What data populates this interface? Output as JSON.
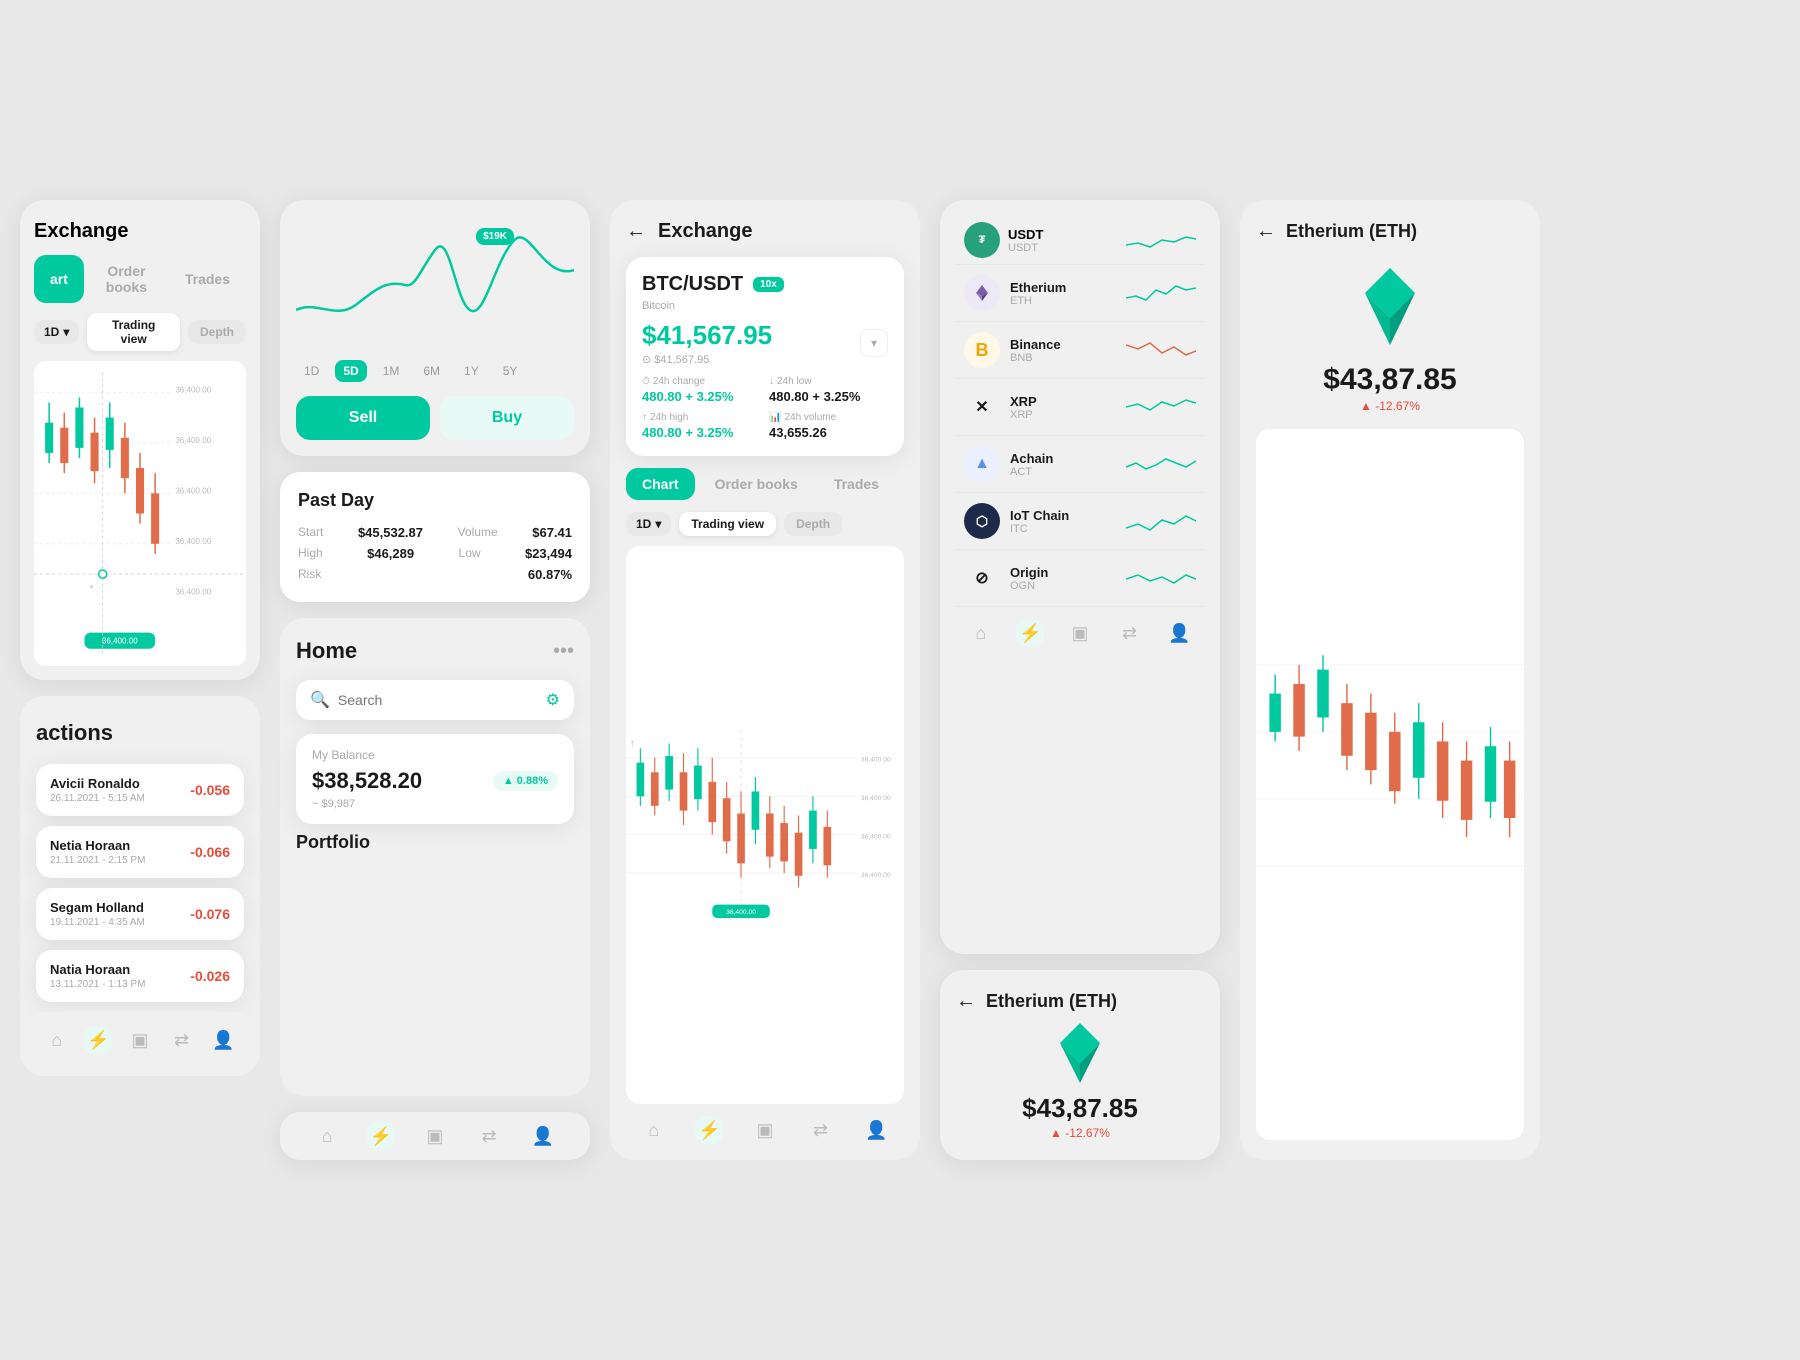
{
  "transactions": {
    "title": "actions",
    "items": [
      {
        "name": "Avicii Ronaldo",
        "date": "26.11.2021 - 5:15 AM",
        "amount": "-0.056"
      },
      {
        "name": "Netia Horaan",
        "date": "21.11.2021 - 2:15 PM",
        "amount": "-0.066"
      },
      {
        "name": "Segam Holland",
        "date": "19.11.2021 - 4:35 AM",
        "amount": "-0.076"
      },
      {
        "name": "Natia Horaan",
        "date": "13.11.2021 - 1:13 PM",
        "amount": "-0.026"
      }
    ]
  },
  "chart": {
    "badge": "$19K",
    "timeFilters": [
      "1D",
      "5D",
      "1M",
      "6M",
      "1Y",
      "5Y"
    ],
    "activeFilter": "5D",
    "sell": "Sell",
    "buy": "Buy"
  },
  "pastDay": {
    "title": "Past Day",
    "start_label": "Start",
    "start_value": "$45,532.87",
    "volume_label": "Volume",
    "volume_value": "$67.41",
    "high_label": "High",
    "high_value": "$46,289",
    "low_label": "Low",
    "low_value": "$23,494",
    "risk_label": "Risk",
    "risk_value": "60.87%"
  },
  "home": {
    "title": "Home",
    "search_placeholder": "Search",
    "balance_label": "My Balance",
    "balance_amount": "$38,528.20",
    "balance_change": "0.88%",
    "balance_sub": "~ $9,987",
    "portfolio_label": "Portfolio"
  },
  "exchange": {
    "title": "Exchange",
    "pair": "BTC/USDT",
    "leverage": "10x",
    "coin": "Bitcoin",
    "price": "$41,567.95",
    "price_sub": "⊙ $41,567.95",
    "change_label": "24h change",
    "change_value": "480.80 + 3.25%",
    "low_label": "24h low",
    "low_value": "480.80 + 3.25%",
    "high_label": "24h high",
    "high_value": "480.80 + 3.25%",
    "volume_label": "24h volume",
    "volume_value": "43,655.26",
    "tabs": [
      "Chart",
      "Order books",
      "Trades"
    ],
    "active_tab": "Chart",
    "timeframe": "1D",
    "views": [
      "Trading view",
      "Depth"
    ],
    "active_view": "Trading view",
    "price_levels": [
      "36,400.00",
      "36,400.00",
      "36,400.00",
      "36,400.00",
      "36,400.00"
    ]
  },
  "cryptoList": {
    "items": [
      {
        "name": "Etherium",
        "ticker": "ETH",
        "color": "#7b5ea7",
        "symbol": "◆"
      },
      {
        "name": "Binance",
        "ticker": "BNB",
        "color": "#f0a500",
        "symbol": "B"
      },
      {
        "name": "XRP",
        "ticker": "XRP",
        "color": "#1a1a1a",
        "symbol": "✕"
      },
      {
        "name": "Achain",
        "ticker": "ACT",
        "color": "#5b8dee",
        "symbol": "▲"
      },
      {
        "name": "IoT Chain",
        "ticker": "ITC",
        "color": "#2c3e6b",
        "symbol": "⬡"
      },
      {
        "name": "Origin",
        "ticker": "OGN",
        "color": "#1a1a1a",
        "symbol": "⊘"
      }
    ]
  },
  "ethDetail": {
    "back": "←",
    "title": "Etherium (ETH)",
    "price": "$43,87.85",
    "change": "▲ -12.67%"
  },
  "ethFull": {
    "back": "←",
    "title": "Etherium (ETH)",
    "price": "$43,87.85",
    "change": "▲ -12.67%"
  },
  "exchangePartial": {
    "title": "Exchange",
    "tabs": [
      "art",
      "Order books",
      "Trades"
    ],
    "views": [
      "Trading view",
      "Depth"
    ]
  }
}
